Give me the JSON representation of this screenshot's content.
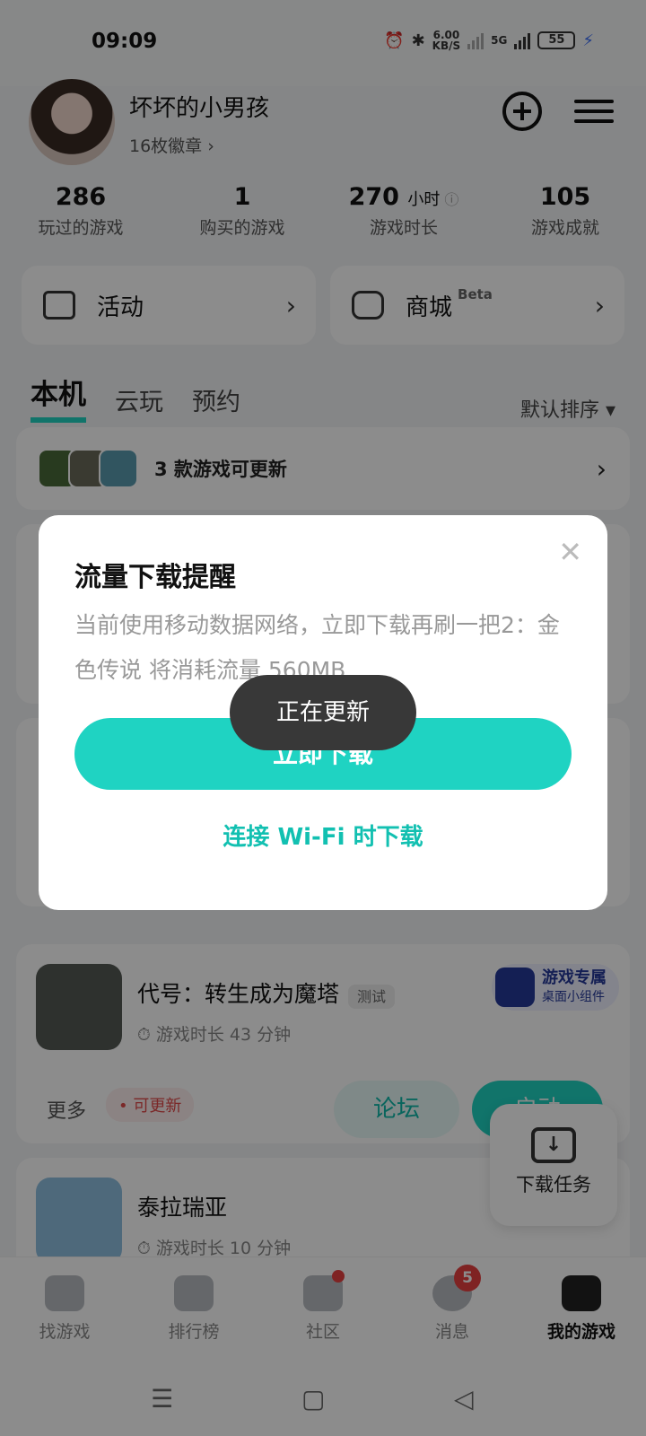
{
  "status_bar": {
    "time": "09:09",
    "net_speed_value": "6.00",
    "net_speed_unit": "KB/S",
    "network": "5G",
    "battery": "55"
  },
  "profile": {
    "username": "坏坏的小男孩",
    "badges": "16枚徽章 ›",
    "stats": [
      {
        "value": "286",
        "unit": "",
        "label": "玩过的游戏"
      },
      {
        "value": "1",
        "unit": "",
        "label": "购买的游戏"
      },
      {
        "value": "270",
        "unit": "小时",
        "label": "游戏时长"
      },
      {
        "value": "105",
        "unit": "",
        "label": "游戏成就"
      }
    ]
  },
  "cards": {
    "activity": "活动",
    "mall": "商城",
    "mall_badge": "Beta"
  },
  "tabs": {
    "items": [
      "本机",
      "云玩",
      "预约"
    ],
    "active": "本机",
    "sort": "默认排序 ▾"
  },
  "update_row": {
    "text": "3 款游戏可更新"
  },
  "games": [
    {
      "name": "代号：转生成为魔塔",
      "tag": "测试",
      "playtime": "游戏时长 43 分钟",
      "widget_title": "游戏专属",
      "widget_sub": "桌面小组件",
      "more": "更多",
      "update_badge": "• 可更新",
      "forum": "论坛",
      "launch": "启动"
    },
    {
      "name": "泰拉瑞亚",
      "playtime": "游戏时长 10 分钟"
    }
  ],
  "download_float": {
    "label": "下载任务"
  },
  "bottom_nav": [
    {
      "label": "找游戏",
      "badge": ""
    },
    {
      "label": "排行榜",
      "badge": ""
    },
    {
      "label": "社区",
      "badge": "dot"
    },
    {
      "label": "消息",
      "badge": "5"
    },
    {
      "label": "我的游戏",
      "badge": ""
    }
  ],
  "dialog": {
    "title": "流量下载提醒",
    "message": "当前使用移动数据网络，立即下载再刷一把2：金色传说 将消耗流量 560MB",
    "primary": "立即下载",
    "secondary": "连接 Wi-Fi 时下载"
  },
  "toast": {
    "text": "正在更新"
  },
  "colors": {
    "accent": "#1fd3c2",
    "accent_text": "#12c0b1",
    "alert": "#e84040"
  }
}
